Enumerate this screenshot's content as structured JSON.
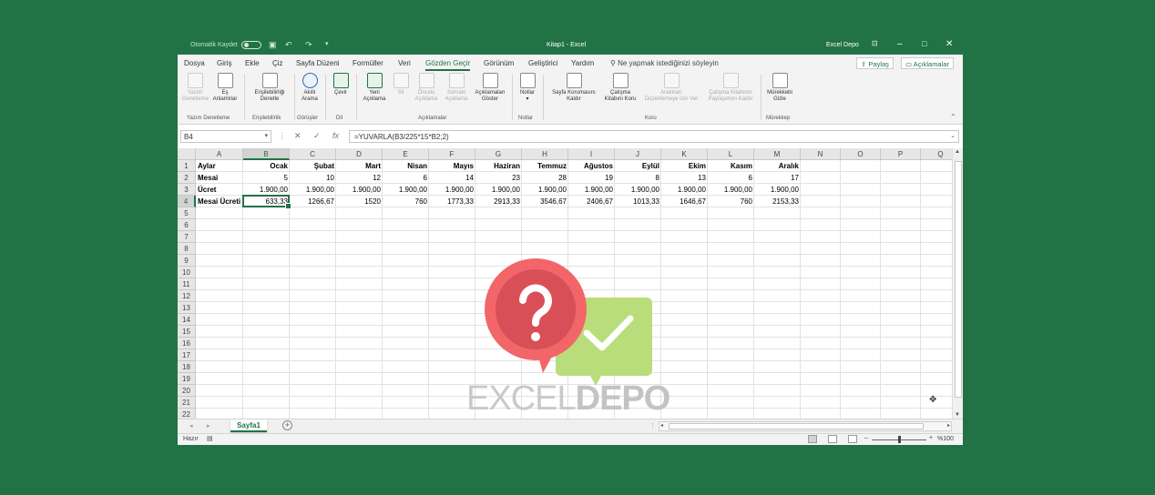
{
  "titlebar": {
    "autosave_label": "Otomatik Kaydet",
    "doc_title": "Kitap1 - Excel",
    "user": "Excel Depo",
    "undo_icon": "undo-icon",
    "redo_icon": "redo-icon"
  },
  "menu": {
    "items": [
      "Dosya",
      "Giriş",
      "Ekle",
      "Çiz",
      "Sayfa Düzeni",
      "Formüller",
      "Veri",
      "Gözden Geçir",
      "Görünüm",
      "Geliştirici",
      "Yardım"
    ],
    "active": "Gözden Geçir",
    "search_placeholder": "Ne yapmak istediğinizi söyleyin",
    "share": "Paylaş",
    "comments": "Açıklamalar"
  },
  "ribbon": {
    "buttons": [
      {
        "label1": "Yazım",
        "label2": "Denetleme",
        "disabled": true
      },
      {
        "label1": "Eş",
        "label2": "Anlamlılar",
        "disabled": false
      },
      {
        "label1": "Erişilebilirliği",
        "label2": "Denetle",
        "disabled": false
      },
      {
        "label1": "Akıllı",
        "label2": "Arama",
        "disabled": false
      },
      {
        "label1": "Çevir",
        "label2": "",
        "disabled": false
      },
      {
        "label1": "Yeni",
        "label2": "Açıklama",
        "disabled": false
      },
      {
        "label1": "Sil",
        "label2": "",
        "disabled": true
      },
      {
        "label1": "Önceki",
        "label2": "Açıklama",
        "disabled": true
      },
      {
        "label1": "Sonraki",
        "label2": "Açıklama",
        "disabled": true
      },
      {
        "label1": "Açıklamaları",
        "label2": "Göster",
        "disabled": false
      },
      {
        "label1": "Notlar",
        "label2": "▾",
        "disabled": false
      },
      {
        "label1": "Sayfa Korumasını",
        "label2": "Kaldır",
        "disabled": false
      },
      {
        "label1": "Çalışma",
        "label2": "Kitabını Koru",
        "disabled": false
      },
      {
        "label1": "Aralıkları",
        "label2": "Düzenlemeye İzin Ver",
        "disabled": true
      },
      {
        "label1": "Çalışma Kitabının",
        "label2": "Paylaşımını Kaldır",
        "disabled": true
      },
      {
        "label1": "Mürekkebi",
        "label2": "Gizle",
        "disabled": false
      }
    ],
    "groups": [
      "Yazım Denetleme",
      "Erişilebilirlik",
      "Görüşler",
      "Dil",
      "Açıklamalar",
      "Notlar",
      "Koru",
      "Mürekkep"
    ]
  },
  "formula_bar": {
    "name_box": "B4",
    "formula": "=YUVARLA(B3/225*15*B2;2)"
  },
  "columns": [
    "A",
    "B",
    "C",
    "D",
    "E",
    "F",
    "G",
    "H",
    "I",
    "J",
    "K",
    "L",
    "M",
    "N",
    "O",
    "P",
    "Q"
  ],
  "rows": [
    "1",
    "2",
    "3",
    "4",
    "5",
    "6",
    "7",
    "8",
    "9",
    "10",
    "11",
    "12",
    "13",
    "14",
    "15",
    "16",
    "17",
    "18",
    "19",
    "20",
    "21",
    "22"
  ],
  "sheet": {
    "headers": [
      "Aylar",
      "Ocak",
      "Şubat",
      "Mart",
      "Nisan",
      "Mayıs",
      "Haziran",
      "Temmuz",
      "Ağustos",
      "Eylül",
      "Ekim",
      "Kasım",
      "Aralık"
    ],
    "mesai": [
      "Mesai",
      "5",
      "10",
      "12",
      "6",
      "14",
      "23",
      "28",
      "19",
      "8",
      "13",
      "6",
      "17"
    ],
    "ucret": [
      "Ücret",
      "1.900,00",
      "1.900,00",
      "1.900,00",
      "1.900,00",
      "1.900,00",
      "1.900,00",
      "1.900,00",
      "1.900,00",
      "1.900,00",
      "1.900,00",
      "1.900,00",
      "1.900,00"
    ],
    "mesai_ucreti": [
      "Mesai Ücreti",
      "633,33",
      "1266,67",
      "1520",
      "760",
      "1773,33",
      "2913,33",
      "3546,67",
      "2406,67",
      "1013,33",
      "1646,67",
      "760",
      "2153,33"
    ]
  },
  "tabs": {
    "sheet_name": "Sayfa1"
  },
  "status": {
    "ready": "Hazır",
    "zoom": "%100"
  },
  "logo": {
    "text_light": "EXCEL",
    "text_bold": "DEPO"
  },
  "colors": {
    "excel_green": "#217346",
    "question_bubble": "#e8555a",
    "check_bubble": "#b9dd7a"
  }
}
